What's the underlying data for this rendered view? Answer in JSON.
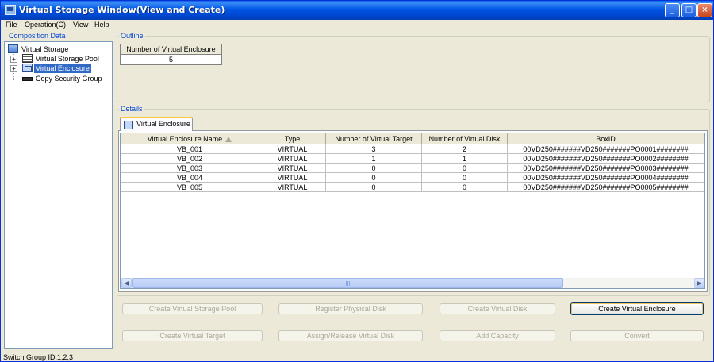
{
  "window": {
    "title": "Virtual Storage Window(View and Create)",
    "controls": {
      "minimize": "_",
      "maximize": "□",
      "close": "×"
    }
  },
  "menu": [
    "File",
    "Operation(C)",
    "View",
    "Help"
  ],
  "left_panel": {
    "header": "Composition Data",
    "tree": {
      "root": "Virtual Storage",
      "children": [
        "Virtual Storage Pool",
        "Virtual Enclosure",
        "Copy Security Group"
      ],
      "selected": "Virtual Enclosure"
    }
  },
  "outline": {
    "header": "Outline",
    "column": "Number of Virtual Enclosure",
    "value": "5"
  },
  "details": {
    "header": "Details",
    "tab_label": "Virtual Enclosure",
    "columns": [
      "Virtual Enclosure Name",
      "Type",
      "Number of Virtual Target",
      "Number of Virtual Disk",
      "BoxID"
    ],
    "rows": [
      [
        "VB_001",
        "VIRTUAL",
        "3",
        "2",
        "00VD250#######VD250#######PO0001########"
      ],
      [
        "VB_002",
        "VIRTUAL",
        "1",
        "1",
        "00VD250#######VD250#######PO0002########"
      ],
      [
        "VB_003",
        "VIRTUAL",
        "0",
        "0",
        "00VD250#######VD250#######PO0003########"
      ],
      [
        "VB_004",
        "VIRTUAL",
        "0",
        "0",
        "00VD250#######VD250#######PO0004########"
      ],
      [
        "VB_005",
        "VIRTUAL",
        "0",
        "0",
        "00VD250#######VD250#######PO0005########"
      ]
    ]
  },
  "buttons": {
    "create_virtual_storage_pool": "Create Virtual Storage Pool",
    "register_physical_disk": "Register Physical Disk",
    "create_virtual_disk": "Create Virtual Disk",
    "create_virtual_enclosure": "Create Virtual Enclosure",
    "create_virtual_target": "Create Virtual Target",
    "assign_release_virtual_disk": "Assign/Release Virtual Disk",
    "add_capacity": "Add Capacity",
    "convert": "Convert"
  },
  "status": {
    "text": "Switch Group ID:1,2,3"
  }
}
